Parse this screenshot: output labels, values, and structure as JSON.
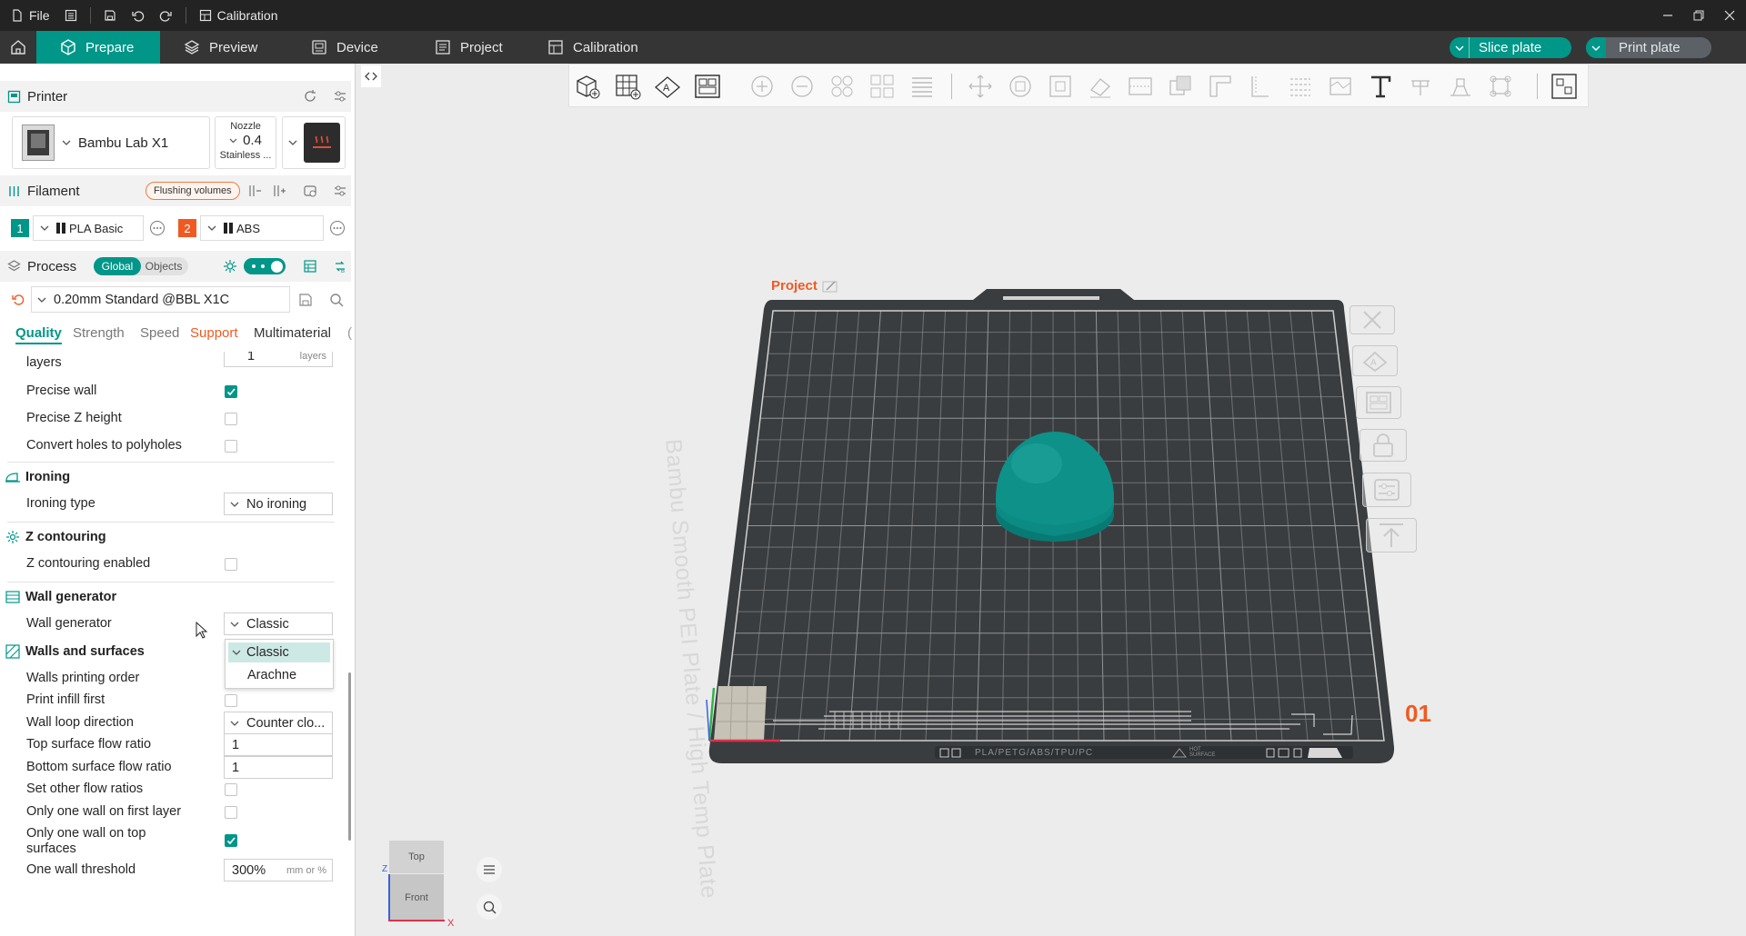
{
  "titlebar": {
    "file": "File",
    "calibration": "Calibration"
  },
  "nav": {
    "tabs": [
      {
        "label": "Prepare"
      },
      {
        "label": "Preview"
      },
      {
        "label": "Device"
      },
      {
        "label": "Project"
      },
      {
        "label": "Calibration"
      }
    ],
    "slice_label": "Slice plate",
    "print_label": "Print plate"
  },
  "printer": {
    "title": "Printer",
    "name": "Bambu Lab X1",
    "nozzle_label": "Nozzle",
    "nozzle_value": "0.4",
    "nozzle_type": "Stainless ..."
  },
  "filament": {
    "title": "Filament",
    "flushing": "Flushing volumes",
    "slots": [
      {
        "num": "1",
        "name": "PLA Basic",
        "color": "#009688"
      },
      {
        "num": "2",
        "name": "ABS",
        "color": "#f05a22"
      }
    ]
  },
  "process": {
    "title": "Process",
    "global": "Global",
    "objects": "Objects",
    "preset": "0.20mm Standard @BBL X1C",
    "tabs": [
      "Quality",
      "Strength",
      "Speed",
      "Support",
      "Multimaterial",
      "("
    ]
  },
  "settings": {
    "top_partial": {
      "label": "layers",
      "value": "1",
      "unit": "layers"
    },
    "precise_wall": {
      "label": "Precise wall",
      "checked": true
    },
    "precise_z": {
      "label": "Precise Z height",
      "checked": false
    },
    "holes_polyholes": {
      "label": "Convert holes to polyholes",
      "checked": false
    },
    "ironing_group": "Ironing",
    "ironing_type": {
      "label": "Ironing type",
      "value": "No ironing"
    },
    "zcontour_group": "Z contouring",
    "zcontour_enabled": {
      "label": "Z contouring enabled",
      "checked": false
    },
    "wallgen_group": "Wall generator",
    "wall_generator": {
      "label": "Wall generator",
      "value": "Classic",
      "options": [
        "Classic",
        "Arachne"
      ]
    },
    "walls_group": "Walls and surfaces",
    "walls_order": {
      "label": "Walls printing order"
    },
    "infill_first": {
      "label": "Print infill first",
      "checked": false
    },
    "wall_loop_dir": {
      "label": "Wall loop direction",
      "value": "Counter clo..."
    },
    "top_flow": {
      "label": "Top surface flow ratio",
      "value": "1"
    },
    "bottom_flow": {
      "label": "Bottom surface flow ratio",
      "value": "1"
    },
    "other_flow": {
      "label": "Set other flow ratios",
      "checked": false
    },
    "one_wall_first": {
      "label": "Only one wall on first layer",
      "checked": false
    },
    "one_wall_top": {
      "label_line1": "Only one wall on top",
      "label_line2": "surfaces",
      "checked": true
    },
    "one_wall_threshold": {
      "label": "One wall threshold",
      "value": "300%",
      "unit": "mm or %"
    }
  },
  "viewport": {
    "project_label": "Project",
    "plate_text": "Bambu Smooth PEI Plate / High Temp Plate",
    "plate_number": "01",
    "plate_footer": "PLA/PETG/ABS/TPU/PC",
    "plate_footer_small": "HOT SURFACE",
    "cube_top": "Top",
    "cube_front": "Front",
    "axis_x": "X",
    "axis_z": "Z"
  },
  "colors": {
    "accent": "#009688",
    "orange": "#f05a22",
    "model": "#0e8a84",
    "bed": "#3a3d3f"
  }
}
